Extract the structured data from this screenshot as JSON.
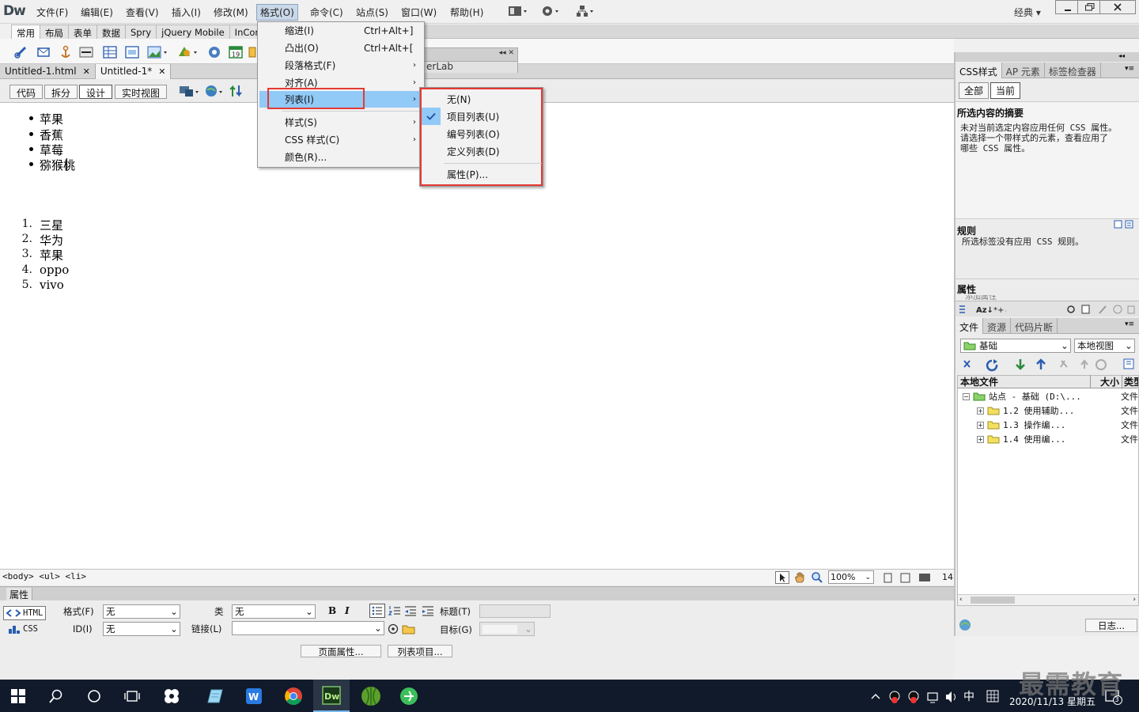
{
  "app": {
    "logo": "Dw",
    "workspace": "经典"
  },
  "menubar": [
    "文件(F)",
    "编辑(E)",
    "查看(V)",
    "插入(I)",
    "修改(M)",
    "格式(O)",
    "命令(C)",
    "站点(S)",
    "窗口(W)",
    "帮助(H)"
  ],
  "insert_tabs": [
    "常用",
    "布局",
    "表单",
    "数据",
    "Spry",
    "jQuery Mobile",
    "InCont"
  ],
  "doc_tabs": [
    {
      "label": "Untitled-1.html"
    },
    {
      "label": "Untitled-1*"
    }
  ],
  "hidden_panel_title": "erLab",
  "view_buttons": [
    "代码",
    "拆分",
    "设计",
    "实时视图"
  ],
  "design": {
    "bullets": [
      "苹果",
      "香蕉",
      "草莓",
      "猕猴桃"
    ],
    "ordered": [
      {
        "n": "1.",
        "t": "三星"
      },
      {
        "n": "2.",
        "t": "华为"
      },
      {
        "n": "3.",
        "t": "苹果"
      },
      {
        "n": "4.",
        "t": "oppo"
      },
      {
        "n": "5.",
        "t": "vivo"
      }
    ]
  },
  "format_menu": {
    "items": [
      {
        "label": "缩进(I)",
        "shortcut": "Ctrl+Alt+]"
      },
      {
        "label": "凸出(O)",
        "shortcut": "Ctrl+Alt+["
      },
      {
        "label": "段落格式(F)",
        "arrow": "›"
      },
      {
        "label": "对齐(A)",
        "arrow": "›"
      },
      {
        "label": "列表(I)",
        "arrow": "›"
      },
      {
        "label": "样式(S)",
        "arrow": "›"
      },
      {
        "label": "CSS 样式(C)",
        "arrow": "›"
      },
      {
        "label": "颜色(R)..."
      }
    ]
  },
  "list_menu": {
    "items": [
      "无(N)",
      "项目列表(U)",
      "编号列表(O)",
      "定义列表(D)",
      "属性(P)..."
    ]
  },
  "status": {
    "tag_selector": "<body> <ul> <li>",
    "zoom": "100%",
    "size_partial": "14"
  },
  "properties": {
    "header": "属性",
    "html_btn": "HTML",
    "css_btn": "CSS",
    "format_label": "格式(F)",
    "format_value": "无",
    "id_label": "ID(I)",
    "id_value": "无",
    "class_label": "类",
    "class_value": "无",
    "link_label": "链接(L)",
    "title_label": "标题(T)",
    "target_label": "目标(G)",
    "page_props_btn": "页面属性...",
    "list_item_btn": "列表项目..."
  },
  "right_panel": {
    "tabs1": [
      "CSS样式",
      "AP 元素",
      "标签检查器"
    ],
    "toggle": [
      "全部",
      "当前"
    ],
    "summary_title": "所选内容的摘要",
    "summary_text": [
      "未对当前选定内容应用任何 CSS 属性。",
      "请选择一个带样式的元素，查看应用了",
      "哪些 CSS 属性。"
    ],
    "rules_title": "规则",
    "rules_text": "所选标签没有应用 CSS 规则。",
    "props_title": "属性",
    "add_prop": "添加属性",
    "tabs2": [
      "文件",
      "资源",
      "代码片断"
    ],
    "site_select": "基础",
    "view_select": "本地视图",
    "file_headers": [
      "本地文件",
      "大小",
      "类型"
    ],
    "tree": [
      {
        "name": "站点 - 基础 (D:\\...",
        "type": "文件"
      },
      {
        "name": "1.2 使用辅助...",
        "type": "文件"
      },
      {
        "name": "1.3  操作编...",
        "type": "文件"
      },
      {
        "name": "1.4  使用编...",
        "type": "文件"
      }
    ],
    "log_btn": "日志..."
  },
  "taskbar": {
    "ime": "中",
    "date": "2020/11/13 星期五",
    "badge": "3"
  },
  "watermark": "最需教育"
}
